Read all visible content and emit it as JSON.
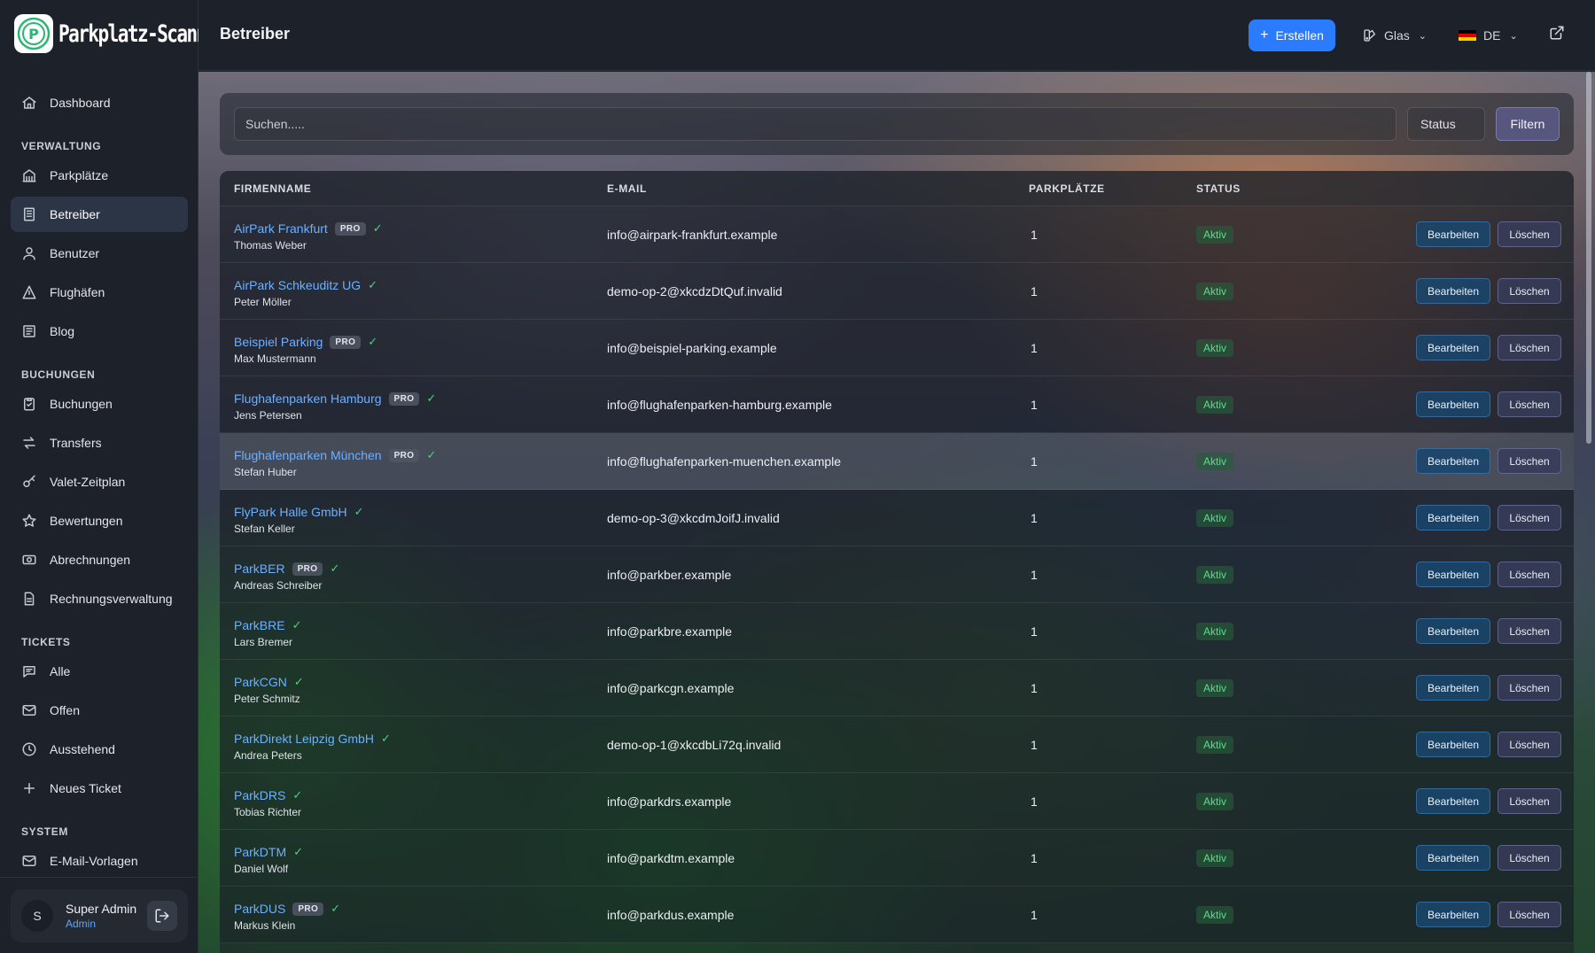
{
  "app": {
    "logo_text": "Parkplatz-Scanner"
  },
  "header": {
    "title": "Betreiber",
    "create_label": "Erstellen",
    "theme_label": "Glas",
    "language_label": "DE"
  },
  "sidebar": {
    "top": [
      {
        "label": "Dashboard",
        "icon": "home-icon"
      }
    ],
    "sections": [
      {
        "title": "VERWALTUNG",
        "items": [
          {
            "label": "Parkplätze",
            "icon": "building-icon"
          },
          {
            "label": "Betreiber",
            "icon": "office-icon",
            "active": true
          },
          {
            "label": "Benutzer",
            "icon": "users-icon"
          },
          {
            "label": "Flughäfen",
            "icon": "plane-icon"
          },
          {
            "label": "Blog",
            "icon": "newspaper-icon"
          }
        ]
      },
      {
        "title": "BUCHUNGEN",
        "items": [
          {
            "label": "Buchungen",
            "icon": "clipboard-icon"
          },
          {
            "label": "Transfers",
            "icon": "arrows-icon"
          },
          {
            "label": "Valet-Zeitplan",
            "icon": "key-icon"
          },
          {
            "label": "Bewertungen",
            "icon": "star-icon"
          },
          {
            "label": "Abrechnungen",
            "icon": "cash-icon"
          },
          {
            "label": "Rechnungsverwaltung",
            "icon": "document-icon"
          }
        ]
      },
      {
        "title": "TICKETS",
        "items": [
          {
            "label": "Alle",
            "icon": "chat-icon"
          },
          {
            "label": "Offen",
            "icon": "mail-icon"
          },
          {
            "label": "Ausstehend",
            "icon": "clock-icon"
          },
          {
            "label": "Neues Ticket",
            "icon": "plus-icon"
          }
        ]
      },
      {
        "title": "SYSTEM",
        "items": [
          {
            "label": "E-Mail-Vorlagen",
            "icon": "mail-icon"
          }
        ]
      }
    ],
    "user": {
      "initial": "S",
      "name": "Super Admin",
      "role": "Admin"
    }
  },
  "filters": {
    "search_placeholder": "Suchen.....",
    "status_label": "Status",
    "filter_label": "Filtern"
  },
  "table": {
    "columns": [
      "FIRMENNAME",
      "E-MAIL",
      "PARKPLÄTZE",
      "STATUS"
    ],
    "edit_label": "Bearbeiten",
    "delete_label": "Löschen",
    "pro_label": "PRO",
    "rows": [
      {
        "name": "AirPark Frankfurt",
        "contact": "Thomas Weber",
        "pro": true,
        "email": "info@airpark-frankfurt.example",
        "spots": "1",
        "status": "Aktiv"
      },
      {
        "name": "AirPark Schkeuditz UG",
        "contact": "Peter Möller",
        "pro": false,
        "email": "demo-op-2@xkcdzDtQuf.invalid",
        "spots": "1",
        "status": "Aktiv"
      },
      {
        "name": "Beispiel Parking",
        "contact": "Max Mustermann",
        "pro": true,
        "email": "info@beispiel-parking.example",
        "spots": "1",
        "status": "Aktiv"
      },
      {
        "name": "Flughafenparken Hamburg",
        "contact": "Jens Petersen",
        "pro": true,
        "email": "info@flughafenparken-hamburg.example",
        "spots": "1",
        "status": "Aktiv"
      },
      {
        "name": "Flughafenparken München",
        "contact": "Stefan Huber",
        "pro": true,
        "email": "info@flughafenparken-muenchen.example",
        "spots": "1",
        "status": "Aktiv",
        "hovered": true
      },
      {
        "name": "FlyPark Halle GmbH",
        "contact": "Stefan Keller",
        "pro": false,
        "email": "demo-op-3@xkcdmJoifJ.invalid",
        "spots": "1",
        "status": "Aktiv"
      },
      {
        "name": "ParkBER",
        "contact": "Andreas Schreiber",
        "pro": true,
        "email": "info@parkber.example",
        "spots": "1",
        "status": "Aktiv"
      },
      {
        "name": "ParkBRE",
        "contact": "Lars Bremer",
        "pro": false,
        "email": "info@parkbre.example",
        "spots": "1",
        "status": "Aktiv"
      },
      {
        "name": "ParkCGN",
        "contact": "Peter Schmitz",
        "pro": false,
        "email": "info@parkcgn.example",
        "spots": "1",
        "status": "Aktiv"
      },
      {
        "name": "ParkDirekt Leipzig GmbH",
        "contact": "Andrea Peters",
        "pro": false,
        "email": "demo-op-1@xkcdbLi72q.invalid",
        "spots": "1",
        "status": "Aktiv"
      },
      {
        "name": "ParkDRS",
        "contact": "Tobias Richter",
        "pro": false,
        "email": "info@parkdrs.example",
        "spots": "1",
        "status": "Aktiv"
      },
      {
        "name": "ParkDTM",
        "contact": "Daniel Wolf",
        "pro": false,
        "email": "info@parkdtm.example",
        "spots": "1",
        "status": "Aktiv"
      },
      {
        "name": "ParkDUS",
        "contact": "Markus Klein",
        "pro": true,
        "email": "info@parkdus.example",
        "spots": "1",
        "status": "Aktiv"
      }
    ]
  },
  "colors": {
    "accent": "#2b7bff",
    "link": "#6cb0ff",
    "status_active": "#5ddc8a",
    "verified": "#4cd27a"
  }
}
